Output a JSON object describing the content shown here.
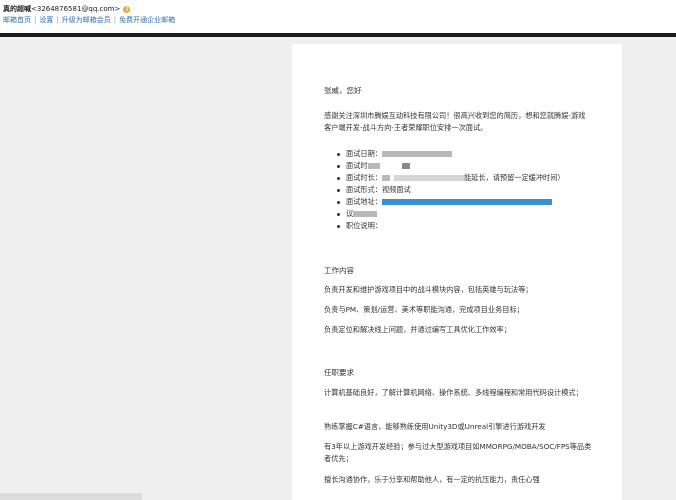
{
  "header": {
    "account_name": "真的超喊",
    "account_email": "<3264876581@qq.com>",
    "links": [
      "邮箱首页",
      "设置",
      "升级为邮箱会员",
      "免费开通企业邮箱"
    ]
  },
  "email": {
    "greeting": "张威，您好",
    "intro": "感谢关注深圳市腾娱互动科技有限公司！很高兴收到您的简历，想和您就腾娱-游戏客户端开发-战斗方向-王者荣耀职位安排一次面试。",
    "details": [
      {
        "prefix": "面试日期："
      },
      {
        "prefix": "面试时"
      },
      {
        "prefix": "面试时长：",
        "suffix": "能延长，请预留一定缓冲时间）"
      },
      {
        "prefix": "面试形式：视频面试"
      },
      {
        "prefix": "面试地址："
      },
      {
        "prefix": "议"
      },
      {
        "prefix": "职位说明："
      }
    ],
    "work_title": "工作内容",
    "work_items": [
      "负责开发和维护游戏项目中的战斗模块内容，包括英雄与玩法等；",
      "负责与PM、策划/运营、美术等职能沟通，完成项目业务目标；",
      "负责定位和解决线上问题，并通过编写工具优化工作效率；"
    ],
    "req_title": "任职要求",
    "req_items": [
      "计算机基础良好，了解计算机网络、操作系统、多线程编程和常用代码设计模式；",
      "熟练掌握C#语言，能够熟练使用Unity3D或Unreal引擎进行游戏开发",
      "有3年以上游戏开发经验；参与过大型游戏项目如MMORPG/MOBA/SOC/FPS等品类者优先；",
      "擅长沟通协作，乐于分享和帮助他人，有一定的抗压能力，责任心强"
    ]
  },
  "colors": {
    "link": "#2f6fb5",
    "warning": "#f5a623",
    "darkbar": "#1c1c1c",
    "redact_blue": "#3a8fd0"
  },
  "icons": {
    "account_status": "warning-icon"
  }
}
